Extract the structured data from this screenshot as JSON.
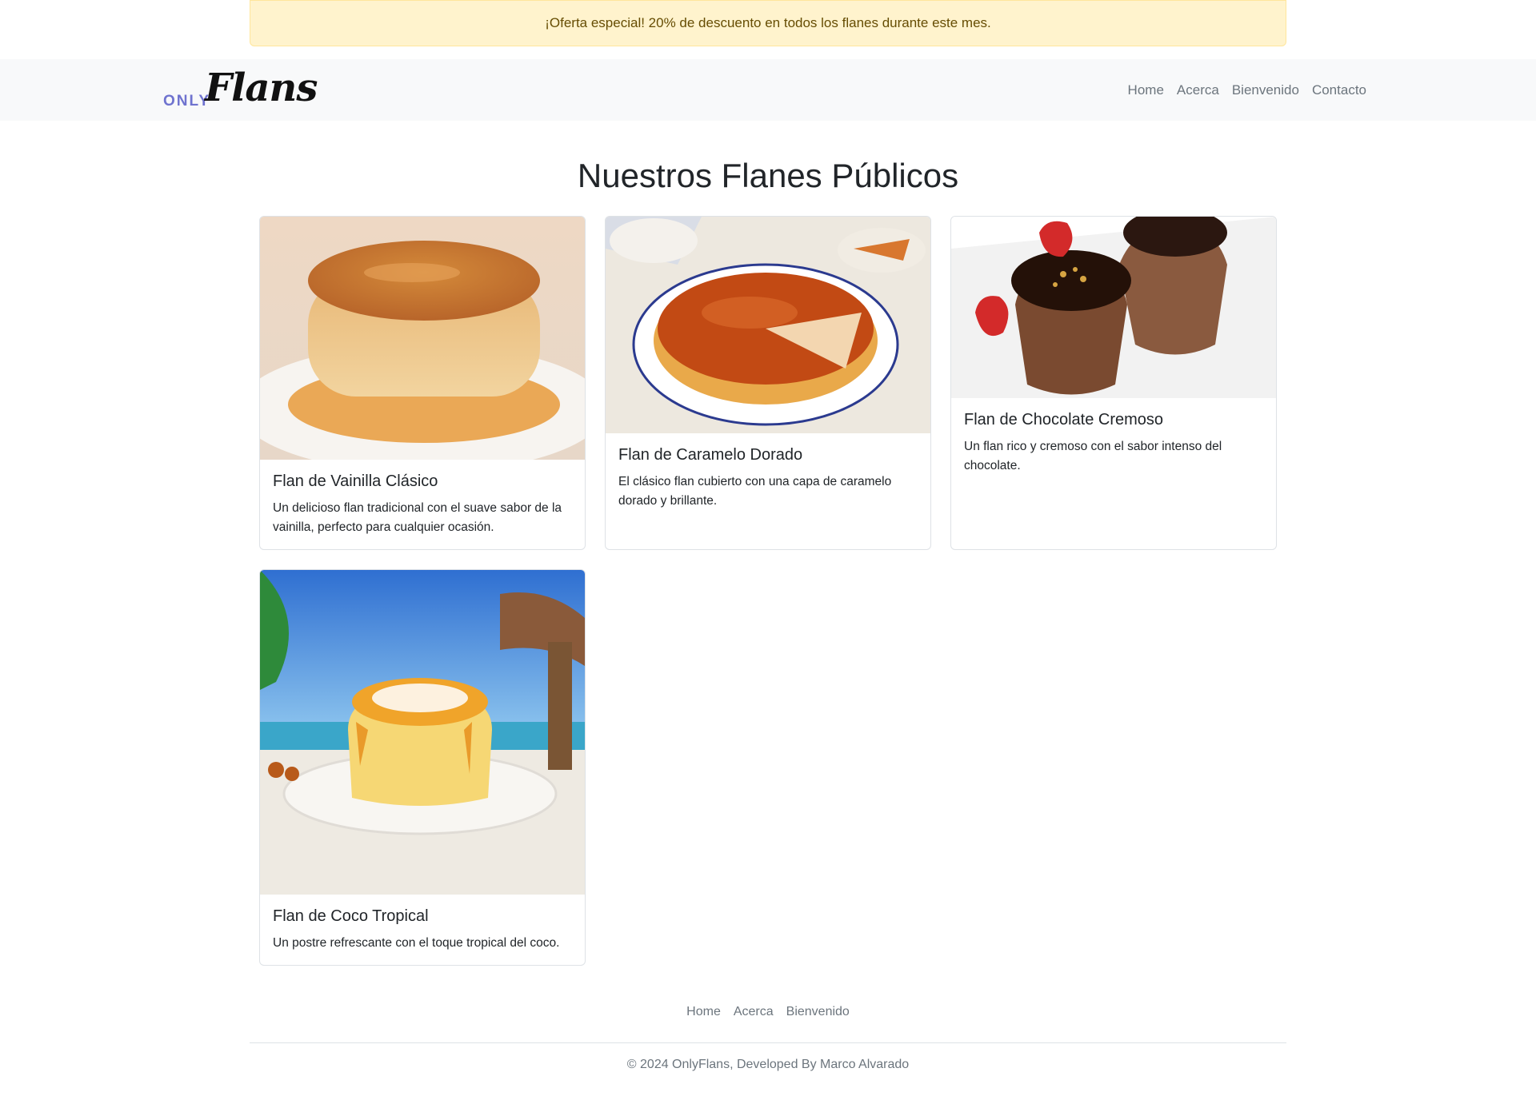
{
  "promo": {
    "text": "¡Oferta especial! 20% de descuento en todos los flanes durante este mes."
  },
  "navbar": {
    "brand_small": "ONLY",
    "brand_large": "Flans",
    "links": [
      "Home",
      "Acerca",
      "Bienvenido",
      "Contacto"
    ]
  },
  "main": {
    "title": "Nuestros Flanes Públicos",
    "cards": [
      {
        "title": "Flan de Vainilla Clásico",
        "description": "Un delicioso flan tradicional con el suave sabor de la vainilla, perfecto para cualquier ocasión.",
        "image": "vanilla-flan-photo"
      },
      {
        "title": "Flan de Caramelo Dorado",
        "description": "El clásico flan cubierto con una capa de caramelo dorado y brillante.",
        "image": "caramel-flan-photo"
      },
      {
        "title": "Flan de Chocolate Cremoso",
        "description": "Un flan rico y cremoso con el sabor intenso del chocolate.",
        "image": "chocolate-flan-photo"
      },
      {
        "title": "Flan de Coco Tropical",
        "description": "Un postre refrescante con el toque tropical del coco.",
        "image": "coconut-flan-photo"
      }
    ]
  },
  "footer": {
    "links": [
      "Home",
      "Acerca",
      "Bienvenido"
    ],
    "copyright": "© 2024 OnlyFlans, Developed By Marco Alvarado"
  },
  "colors": {
    "promo_bg": "#fff3cd",
    "promo_text": "#664d03",
    "navbar_bg": "#f8f9fa",
    "brand_accent": "#6f73cf",
    "link_gray": "#6c757d"
  }
}
